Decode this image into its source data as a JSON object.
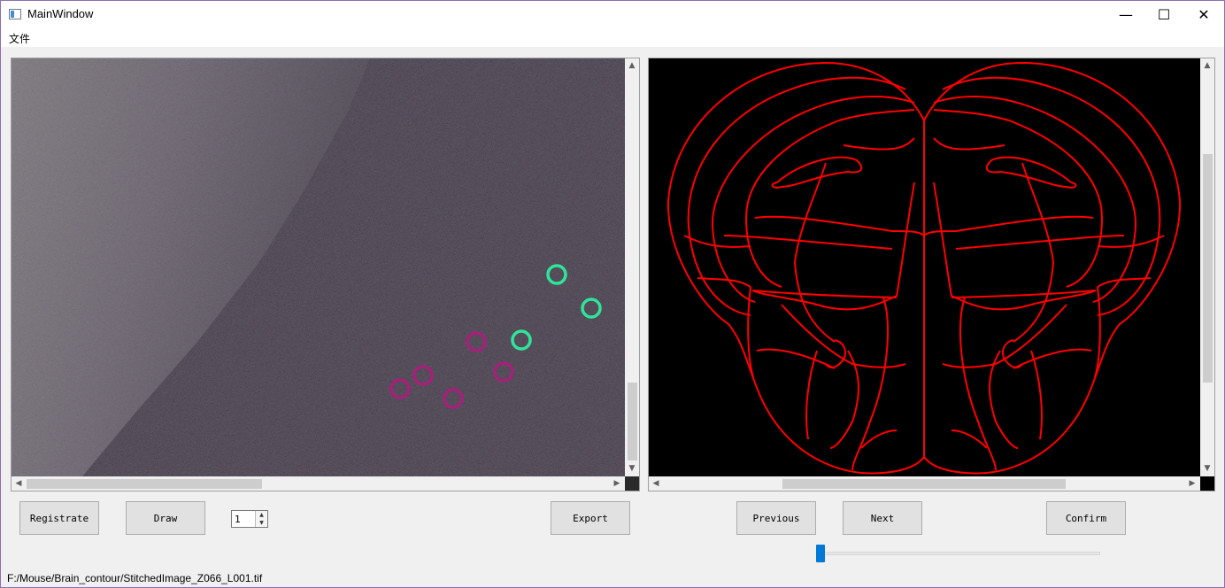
{
  "window": {
    "title": "MainWindow",
    "minimize_glyph": "—",
    "maximize_glyph": "☐",
    "close_glyph": "✕"
  },
  "menu": {
    "items": [
      {
        "label": "文件"
      }
    ]
  },
  "image_view": {
    "markers": {
      "green_color": "#2ee59a",
      "magenta_color": "#a6207a"
    },
    "scroll": {
      "up": "▲",
      "down": "▼",
      "left": "◀",
      "right": "▶"
    }
  },
  "atlas_view": {
    "contour_color": "#ff0000",
    "scroll": {
      "up": "▲",
      "down": "▼",
      "left": "◀",
      "right": "▶"
    }
  },
  "controls": {
    "registrate_label": "Registrate",
    "draw_label": "Draw",
    "spin_value": "1",
    "export_label": "Export",
    "previous_label": "Previous",
    "next_label": "Next",
    "confirm_label": "Confirm",
    "slider_value": 0
  },
  "status_bar": {
    "path": "F:/Mouse/Brain_contour/StitchedImage_Z066_L001.tif"
  }
}
